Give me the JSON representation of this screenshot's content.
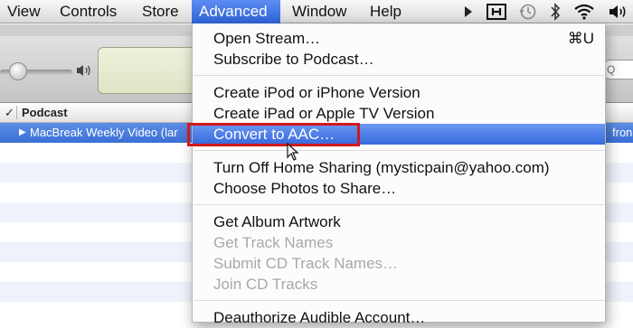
{
  "menubar": {
    "items": [
      {
        "label": "View"
      },
      {
        "label": "Controls"
      },
      {
        "label": "Store"
      },
      {
        "label": "Advanced"
      },
      {
        "label": "Window"
      },
      {
        "label": "Help"
      }
    ],
    "active": "Advanced",
    "status_icons": [
      "play-arrow-icon",
      "display-h-icon",
      "time-machine-icon",
      "bluetooth-icon",
      "wifi-icon",
      "volume-icon"
    ]
  },
  "itunes": {
    "column_header": {
      "check": "✓",
      "podcast": "Podcast"
    },
    "selected_row": {
      "text": "MacBreak Weekly Video (lar",
      "right_text": "fron"
    },
    "search_placeholder": "Q"
  },
  "advanced_menu": {
    "groups": [
      [
        {
          "label": "Open Stream…",
          "shortcut": "⌘U",
          "enabled": true
        },
        {
          "label": "Subscribe to Podcast…",
          "enabled": true
        }
      ],
      [
        {
          "label": "Create iPod or iPhone Version",
          "enabled": true
        },
        {
          "label": "Create iPad or Apple TV Version",
          "enabled": true
        },
        {
          "label": "Convert to AAC…",
          "enabled": true,
          "highlighted": true
        }
      ],
      [
        {
          "label": "Turn Off Home Sharing (mysticpain@yahoo.com)",
          "enabled": true
        },
        {
          "label": "Choose Photos to Share…",
          "enabled": true
        }
      ],
      [
        {
          "label": "Get Album Artwork",
          "enabled": true
        },
        {
          "label": "Get Track Names",
          "enabled": false
        },
        {
          "label": "Submit CD Track Names…",
          "enabled": false
        },
        {
          "label": "Join CD Tracks",
          "enabled": false
        }
      ],
      [
        {
          "label": "Deauthorize Audible Account…",
          "enabled": true
        }
      ]
    ]
  },
  "colors": {
    "highlight": "#3669dd",
    "annotation_box": "#d11a1a",
    "disabled_text": "#a8a8a8"
  }
}
